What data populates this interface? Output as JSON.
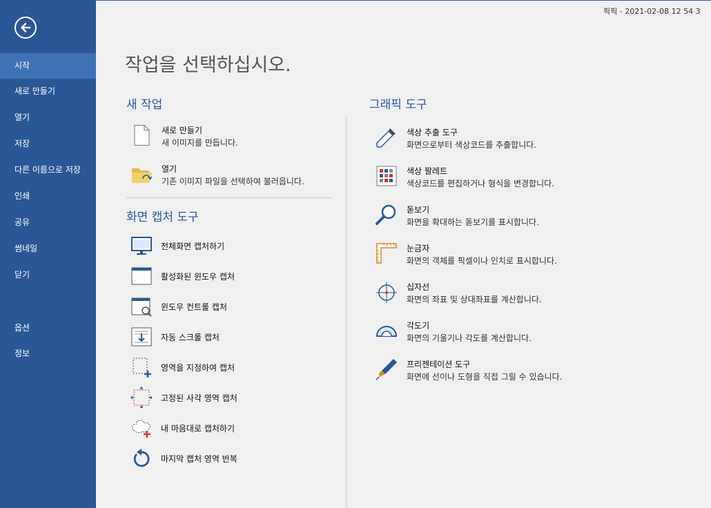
{
  "window": {
    "title": "픽픽 - 2021-02-08 12 54 3"
  },
  "sidebar": {
    "items": [
      {
        "label": "시작"
      },
      {
        "label": "새로 만들기"
      },
      {
        "label": "열기"
      },
      {
        "label": "저장"
      },
      {
        "label": "다른 이름으로 저장"
      },
      {
        "label": "인쇄"
      },
      {
        "label": "공유"
      },
      {
        "label": "썸네일"
      },
      {
        "label": "닫기"
      },
      {
        "label": "옵션"
      },
      {
        "label": "정보"
      }
    ],
    "active_index": 0,
    "colors": {
      "background": "#2b5797",
      "active": "#3f71b5"
    }
  },
  "main": {
    "heading": "작업을 선택하십시오.",
    "new_task": {
      "title": "새 작업",
      "items": [
        {
          "title": "새로 만들기",
          "desc": "새 이미지를 만듭니다.",
          "icon": "new-file-icon"
        },
        {
          "title": "열기",
          "desc": "기존 이미지 파일을 선택하여 불러옵니다.",
          "icon": "open-folder-icon"
        }
      ]
    },
    "capture_tools": {
      "title": "화면 캡처 도구",
      "items": [
        {
          "label": "전체화면 캡처하기",
          "icon": "monitor-icon"
        },
        {
          "label": "활성화된 윈도우 캡처",
          "icon": "active-window-icon"
        },
        {
          "label": "윈도우 컨트롤 캡처",
          "icon": "window-control-icon"
        },
        {
          "label": "자동 스크롤 캡처",
          "icon": "scroll-capture-icon"
        },
        {
          "label": "영역을 지정하여 캡처",
          "icon": "region-capture-icon"
        },
        {
          "label": "고정된 사각 영역 캡처",
          "icon": "fixed-region-icon"
        },
        {
          "label": "내 마음대로 캡처하기",
          "icon": "freehand-capture-icon"
        },
        {
          "label": "마지막 캡처 영역 반복",
          "icon": "repeat-capture-icon"
        }
      ]
    },
    "graphic_tools": {
      "title": "그래픽 도구",
      "items": [
        {
          "title": "색상 추출 도구",
          "desc": "화면으로부터 색상코드를 추출합니다.",
          "icon": "eyedropper-icon"
        },
        {
          "title": "색상 팔레트",
          "desc": "색상코드를 편집하거나 형식을 변경합니다.",
          "icon": "palette-icon"
        },
        {
          "title": "돋보기",
          "desc": "화면을 확대하는 돋보기를 표시합니다.",
          "icon": "magnifier-icon"
        },
        {
          "title": "눈금자",
          "desc": "화면의 객체를 픽셀이나 인치로 표시합니다.",
          "icon": "ruler-icon"
        },
        {
          "title": "십자선",
          "desc": "화면의 좌표 및 상대좌표를 계산합니다.",
          "icon": "crosshair-icon"
        },
        {
          "title": "각도기",
          "desc": "화면의 기울기나 각도를 계산합니다.",
          "icon": "protractor-icon"
        },
        {
          "title": "프리젠테이션 도구",
          "desc": "화면에 선이나 도형을 직접 그릴 수 있습니다.",
          "icon": "pen-icon"
        }
      ]
    }
  }
}
